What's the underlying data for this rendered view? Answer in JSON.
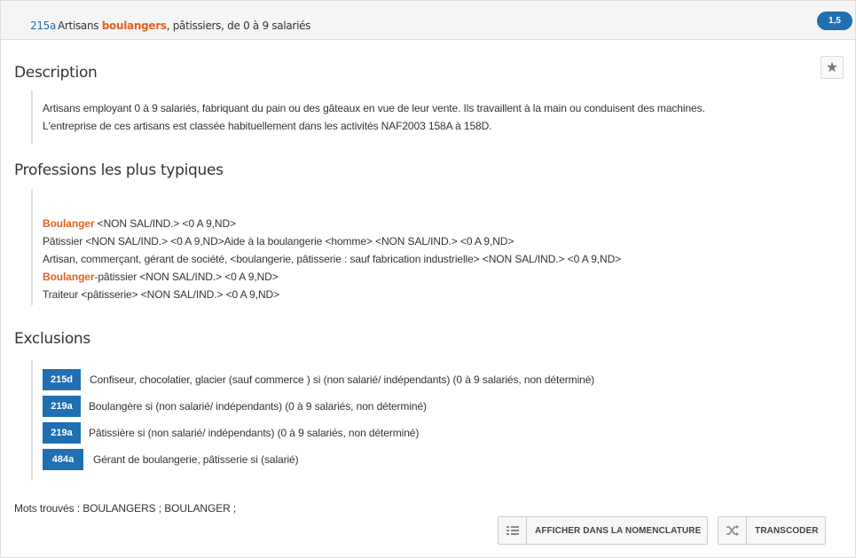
{
  "header": {
    "code": "215a",
    "title_prefix": "Artisans ",
    "title_highlight": "boulangers",
    "title_suffix": ", pâtissiers, de 0 à 9 salariés",
    "score": "1,5"
  },
  "star_icon": "star-icon",
  "description": {
    "title": "Description",
    "lines": [
      "Artisans employant 0 à 9 salariés, fabriquant du pain ou des gâteaux en vue de leur vente. Ils travaillent à la main ou conduisent des machines.",
      "L'entreprise de ces artisans est classée habituellement dans les activités NAF2003 158A à 158D."
    ]
  },
  "professions": {
    "title": "Professions les plus typiques",
    "items": [
      {
        "highlight": "Boulanger",
        "text": " <NON SAL/IND.> <0 A 9,ND>"
      },
      {
        "highlight": "",
        "text": "Pâtissier <NON SAL/IND.> <0 A 9,ND>Aide à la boulangerie <homme> <NON SAL/IND.> <0 A 9,ND>"
      },
      {
        "highlight": "",
        "text": "Artisan, commerçant, gérant de société, <boulangerie, pâtisserie : sauf fabrication industrielle> <NON SAL/IND.> <0 A 9,ND>"
      },
      {
        "highlight": "Boulanger",
        "text": "-pâtissier <NON SAL/IND.> <0 A 9,ND>"
      },
      {
        "highlight": "",
        "text": "Traiteur <pâtisserie> <NON SAL/IND.> <0 A 9,ND>"
      }
    ]
  },
  "exclusions": {
    "title": "Exclusions",
    "items": [
      {
        "code": "215d",
        "text": "Confiseur, chocolatier, glacier (sauf commerce ) si (non salarié/ indépendants) (0 à 9 salariés, non déterminé)"
      },
      {
        "code": "219a",
        "text": "Boulangère si (non salarié/ indépendants) (0 à 9 salariés, non déterminé)"
      },
      {
        "code": "219a",
        "text": "Pâtissière si (non salarié/ indépendants) (0 à 9 salariés, non déterminé)"
      },
      {
        "code": "484a",
        "text": "Gérant de boulangerie, pâtisserie si (salarié)"
      }
    ]
  },
  "mots": "Mots trouvés : BOULANGERS ; BOULANGER ;",
  "buttons": {
    "nomenclature": {
      "label": "AFFICHER DANS LA NOMENCLATURE",
      "icon": "list-icon"
    },
    "transcoder": {
      "label": "TRANSCODER",
      "icon": "shuffle-icon"
    }
  },
  "colors": {
    "accent": "#1f6fb2",
    "highlight": "#e0621f"
  }
}
